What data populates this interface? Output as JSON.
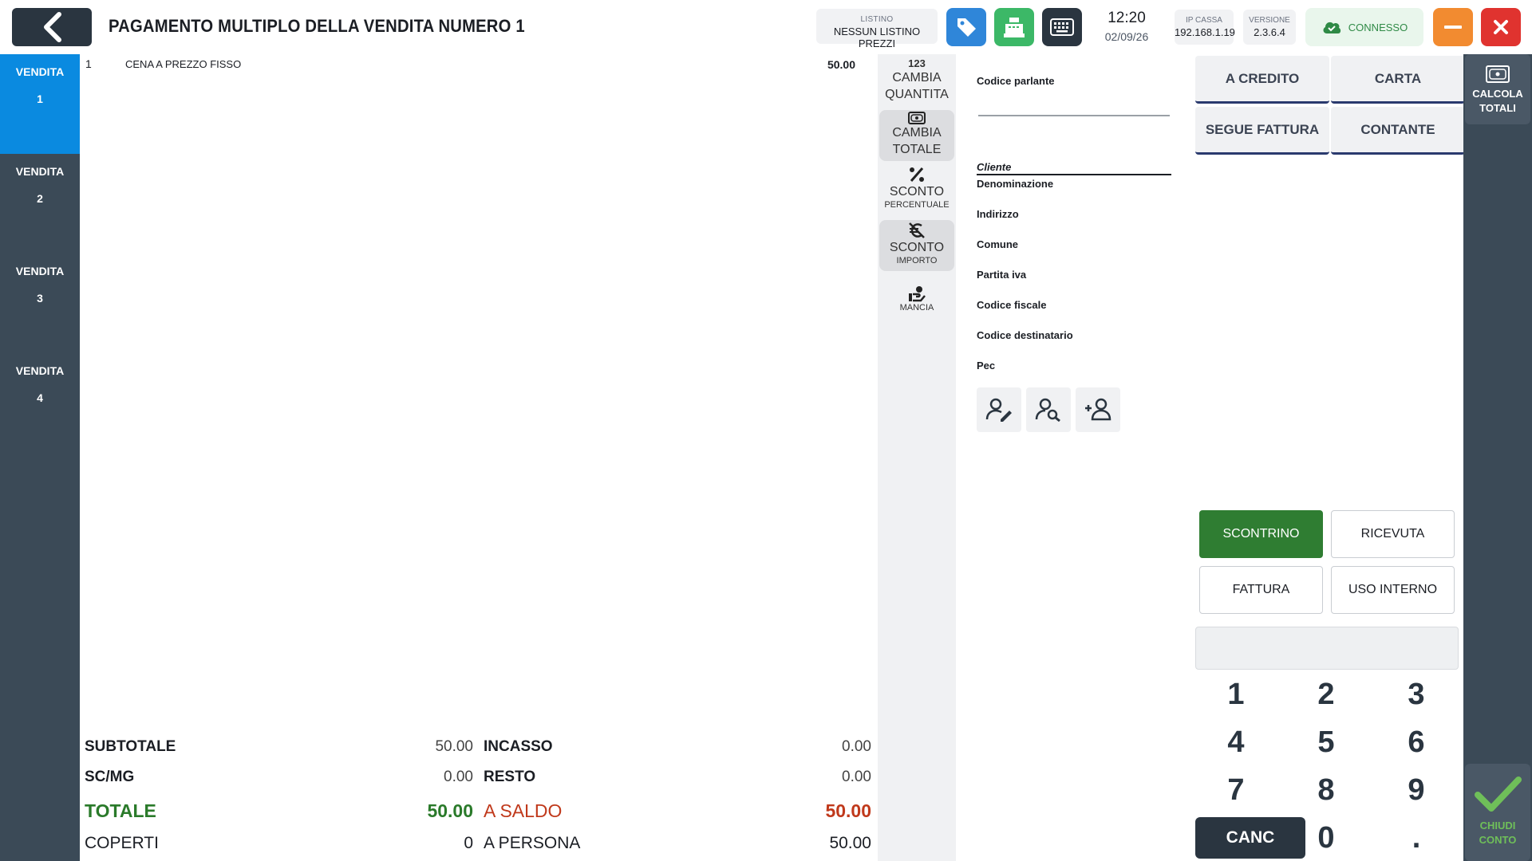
{
  "header": {
    "title": "PAGAMENTO MULTIPLO DELLA VENDITA NUMERO 1",
    "listino_label": "LISTINO",
    "listino_value": "NESSUN LISTINO PREZZI",
    "time": "12:20",
    "date": "02/09/26",
    "ip_label": "IP CASSA",
    "ip_value": "192.168.1.19",
    "version_label": "VERSIONE",
    "version_value": "2.3.6.4",
    "connection_status": "CONNESSO"
  },
  "tabs": [
    {
      "label": "VENDITA",
      "number": "1",
      "active": true
    },
    {
      "label": "VENDITA",
      "number": "2",
      "active": false
    },
    {
      "label": "VENDITA",
      "number": "3",
      "active": false
    },
    {
      "label": "VENDITA",
      "number": "4",
      "active": false
    }
  ],
  "items": [
    {
      "qty": "1",
      "description": "CENA A PREZZO FISSO",
      "price": "50.00"
    }
  ],
  "totals": {
    "subtotale_label": "SUBTOTALE",
    "subtotale": "50.00",
    "scmg_label": "SC/MG",
    "scmg": "0.00",
    "totale_label": "TOTALE",
    "totale": "50.00",
    "coperti_label": "COPERTI",
    "coperti": "0",
    "incasso_label": "INCASSO",
    "incasso": "0.00",
    "resto_label": "RESTO",
    "resto": "0.00",
    "a_saldo_label": "A SALDO",
    "a_saldo": "50.00",
    "a_persona_label": "A PERSONA",
    "a_persona": "50.00"
  },
  "actions": {
    "qty_icon": "123",
    "cambia_quantita": [
      "CAMBIA",
      "QUANTITA"
    ],
    "cambia_totale": [
      "CAMBIA",
      "TOTALE"
    ],
    "sconto_percentuale": [
      "SCONTO",
      "PERCENTUALE"
    ],
    "sconto_importo": [
      "SCONTO",
      "IMPORTO"
    ],
    "mancia": "MANCIA"
  },
  "customer": {
    "codice_parlante": "Codice parlante",
    "cliente": "Cliente",
    "fields": [
      "Denominazione",
      "Indirizzo",
      "Comune",
      "Partita iva",
      "Codice fiscale",
      "Codice destinatario",
      "Pec"
    ]
  },
  "payment": {
    "methods": [
      "A CREDITO",
      "CARTA",
      "SEGUE FATTURA",
      "CONTANTE"
    ],
    "documents": [
      "SCONTRINO",
      "RICEVUTA",
      "FATTURA",
      "USO INTERNO"
    ],
    "keys": [
      "1",
      "2",
      "3",
      "4",
      "5",
      "6",
      "7",
      "8",
      "9",
      "CANC",
      "0",
      "."
    ]
  },
  "rail": {
    "calcola": [
      "CALCOLA",
      "TOTALI"
    ],
    "chiudi": [
      "CHIUDI",
      "CONTO"
    ]
  },
  "colors": {
    "dark": "#2a3540",
    "accent_blue": "#0a8ae0",
    "green": "#2f7d32",
    "red": "#c0391b",
    "orange": "#f28b30"
  }
}
